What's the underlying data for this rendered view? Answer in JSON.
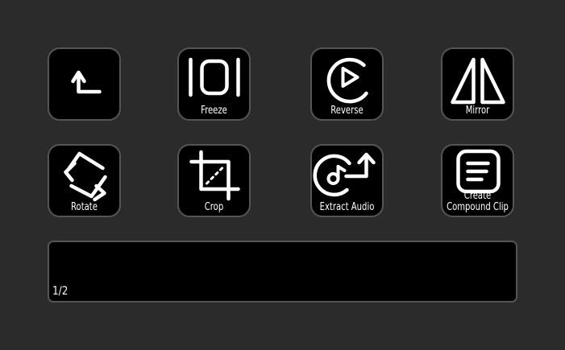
{
  "keys": {
    "back": {
      "icon": "back-arrow-icon"
    },
    "freeze": {
      "label": "Freeze",
      "icon": "freeze-icon"
    },
    "reverse": {
      "label": "Reverse",
      "icon": "reverse-icon"
    },
    "mirror": {
      "label": "Mirror",
      "icon": "mirror-icon"
    },
    "rotate": {
      "label": "Rotate",
      "icon": "rotate-icon"
    },
    "crop": {
      "label": "Crop",
      "icon": "crop-icon"
    },
    "extract_audio": {
      "label": "Extract Audio",
      "icon": "extract-audio-icon"
    },
    "compound_clip": {
      "label_line1": "Create",
      "label_line2": "Compound Clip",
      "icon": "compound-clip-icon"
    }
  },
  "strip": {
    "page_indicator": "1/2"
  },
  "colors": {
    "background": "#2b2b2b",
    "key_fill": "#000000",
    "key_border": "#555555",
    "foreground": "#ffffff"
  }
}
